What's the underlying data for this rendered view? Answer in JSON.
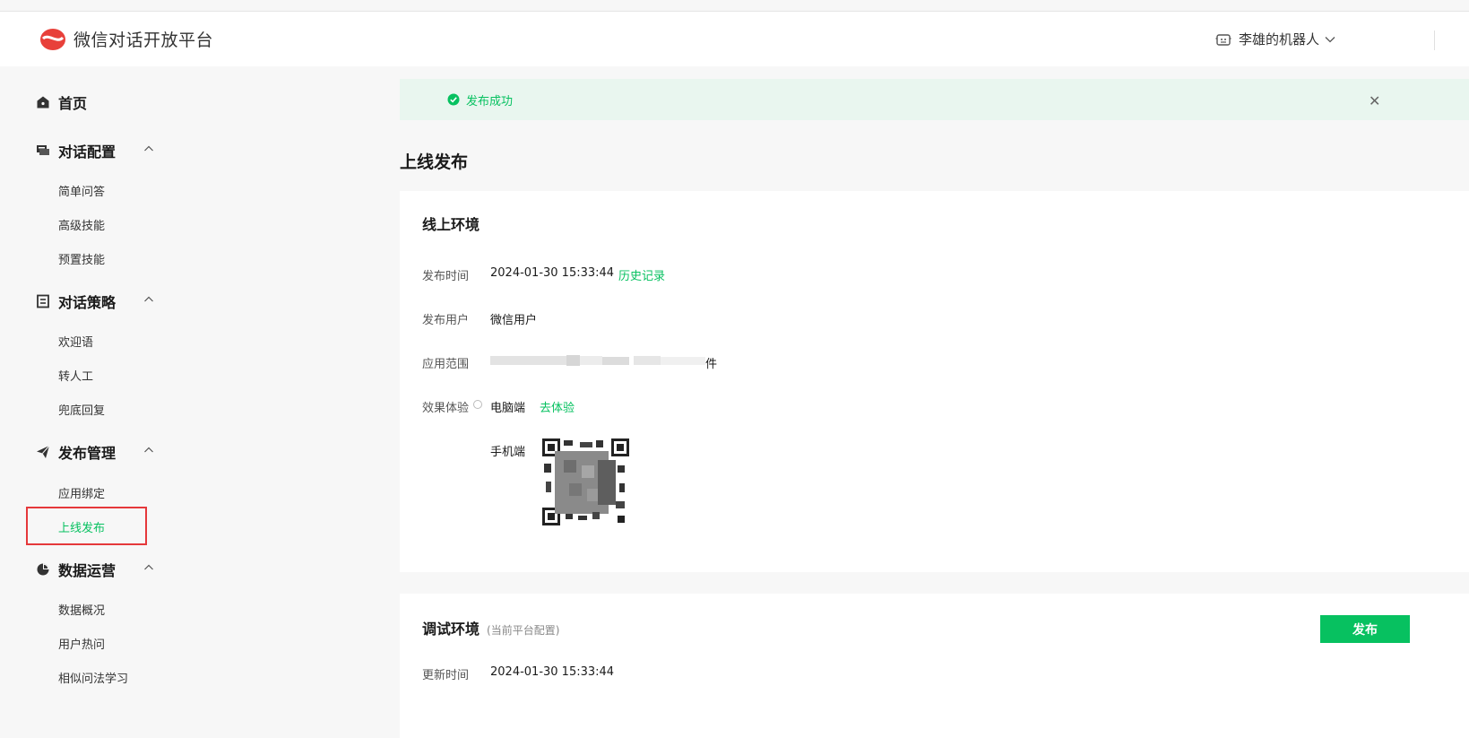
{
  "header": {
    "app_title": "微信对话开放平台",
    "account_name": "李雄的机器人"
  },
  "sidebar": {
    "home": "首页",
    "groups": [
      {
        "label": "对话配置",
        "items": [
          "简单问答",
          "高级技能",
          "预置技能"
        ]
      },
      {
        "label": "对话策略",
        "items": [
          "欢迎语",
          "转人工",
          "兜底回复"
        ]
      },
      {
        "label": "发布管理",
        "items": [
          "应用绑定",
          "上线发布"
        ]
      },
      {
        "label": "数据运营",
        "items": [
          "数据概况",
          "用户热问",
          "相似问法学习"
        ]
      }
    ],
    "active_item": "上线发布"
  },
  "banner": {
    "message": "发布成功"
  },
  "main": {
    "page_title": "上线发布",
    "online": {
      "title": "线上环境",
      "publish_time_label": "发布时间",
      "publish_time_value": "2024-01-30 15:33:44",
      "history_link": "历史记录",
      "publish_user_label": "发布用户",
      "publish_user_value": "微信用户",
      "scope_label": "应用范围",
      "scope_value_visible": "件",
      "experience_label": "效果体验",
      "desktop_label": "电脑端",
      "try_link": "去体验",
      "mobile_label": "手机端"
    },
    "debug": {
      "title": "调试环境",
      "subtitle": "(当前平台配置)",
      "update_time_label": "更新时间",
      "update_time_value": "2024-01-30 15:33:44",
      "publish_button": "发布"
    }
  },
  "colors": {
    "accent": "#07c160",
    "highlight_border": "#e5383b",
    "banner_bg": "#e9f6ef"
  },
  "icons": [
    "logo-icon",
    "robot-icon",
    "chevron-down-icon",
    "home-icon",
    "chat-icon",
    "strategy-icon",
    "send-icon",
    "pie-chart-icon",
    "chevron-up-icon",
    "check-circle-icon",
    "close-icon",
    "info-icon",
    "qr-code-icon"
  ]
}
